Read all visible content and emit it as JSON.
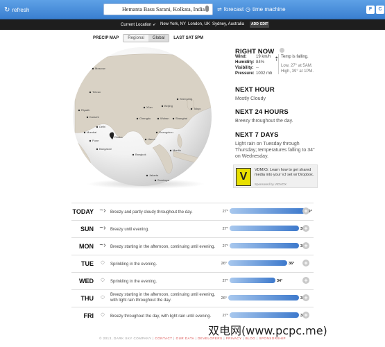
{
  "topbar": {
    "refresh_label": "refresh",
    "search_value": "Hemanta Basu Sarani, Kolkata, India",
    "forecast_label": "forecast",
    "timemachine_label": "time machine",
    "unit_f": "F",
    "unit_c": "C"
  },
  "locbar": {
    "current": "Current Location",
    "cities": [
      "New York, NY",
      "London, UK",
      "Sydney, Australia"
    ],
    "add": "ADD",
    "edit": "EDIT"
  },
  "precip": {
    "label": "PRECIP MAP",
    "tabs": [
      "Regional",
      "Global"
    ],
    "last": "LAST SAT 5PM"
  },
  "globe_cities": [
    "Moscow",
    "Tehran",
    "Riyadh",
    "Karachi",
    "Delhi",
    "Dhaka",
    "Mumbai",
    "Bangalore",
    "Chengdu",
    "Beijing",
    "Shenyang",
    "Tokyo",
    "Shanghai",
    "Wuhan",
    "Guangzhou",
    "Bangkok",
    "Hanoi",
    "Manila",
    "Jakarta",
    "Surabaya",
    "Xi'an",
    "Pune"
  ],
  "right_now": {
    "title": "RIGHT NOW",
    "wind_k": "Wind:",
    "wind_v": "19 km/h",
    "hum_k": "Humidity:",
    "hum_v": "84%",
    "vis_k": "Visibility:",
    "vis_v": "--",
    "pres_k": "Pressure:",
    "pres_v": "1002 mb",
    "temp_note": "Temp is falling.",
    "low": "Low, 27° at 5AM.",
    "high": "High, 39° at 1PM."
  },
  "next_hour": {
    "title": "NEXT HOUR",
    "text": "Mostly Cloudy"
  },
  "next_24": {
    "title": "NEXT 24 HOURS",
    "text": "Breezy throughout the day."
  },
  "next_7": {
    "title": "NEXT 7 DAYS",
    "text": "Light rain on Tuesday through Thursday; temperatures falling to 34° on Wednesday."
  },
  "ad": {
    "logo": "V",
    "text": "VDMX5: Learn how to get shared media into your VJ set w/ Dropbox.",
    "sponsor": "Sponsored by VIDVOX"
  },
  "days": [
    {
      "name": "TODAY",
      "icon": "wind-icon",
      "summary": "Breezy and partly cloudy throughout the day.",
      "lo": "27°",
      "hi": "39°",
      "lo_val": 27,
      "hi_val": 39
    },
    {
      "name": "SUN",
      "icon": "wind-icon",
      "summary": "Breezy until evening.",
      "lo": "27°",
      "hi": "38°",
      "lo_val": 27,
      "hi_val": 38
    },
    {
      "name": "MON",
      "icon": "wind-icon",
      "summary": "Breezy starting in the afternoon, continuing until evening.",
      "lo": "27°",
      "hi": "38°",
      "lo_val": 27,
      "hi_val": 38
    },
    {
      "name": "TUE",
      "icon": "rain-icon",
      "summary": "Sprinkling in the evening.",
      "lo": "26°",
      "hi": "36°",
      "lo_val": 26,
      "hi_val": 36
    },
    {
      "name": "WED",
      "icon": "rain-icon",
      "summary": "Sprinkling in the evening.",
      "lo": "27°",
      "hi": "34°",
      "lo_val": 27,
      "hi_val": 34
    },
    {
      "name": "THU",
      "icon": "rain-icon",
      "summary": "Breezy starting in the afternoon, continuing until evening, with light rain throughout the day.",
      "lo": "26°",
      "hi": "38°",
      "lo_val": 26,
      "hi_val": 38
    },
    {
      "name": "FRI",
      "icon": "rain-icon",
      "summary": "Breezy throughout the day, with light rain until evening.",
      "lo": "27°",
      "hi": "38°",
      "lo_val": 27,
      "hi_val": 38
    }
  ],
  "footer": {
    "copyright": "© 2013, DARK SKY COMPANY |",
    "links": [
      "CONTACT",
      "OUR DATA",
      "DEVELOPERS",
      "PRIVACY",
      "BLOG",
      "SPONSORSHIP"
    ]
  },
  "watermark": "双电网(www.pcpc.me)",
  "colors": {
    "accent": "#3a7fd0",
    "bar_hi": "#3d79cc",
    "bar_lo": "#a8c8ee",
    "dark_bar": "#1e1e1e"
  }
}
